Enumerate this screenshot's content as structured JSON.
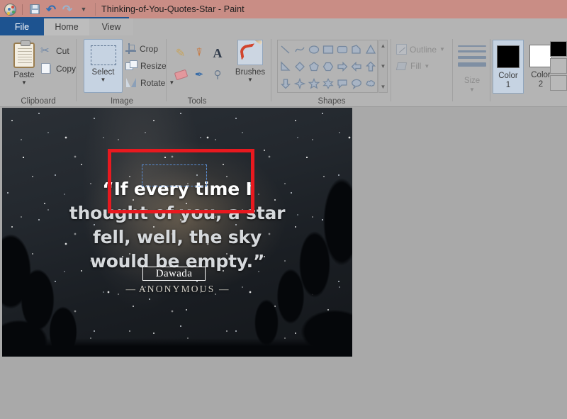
{
  "window": {
    "title": "Thinking-of-You-Quotes-Star - Paint",
    "quick_access": {
      "app_icon": "paint-palette-icon",
      "save": "save-icon",
      "undo": "undo-icon",
      "redo": "redo-icon",
      "customize": "chevron-down-icon"
    }
  },
  "tabs": [
    {
      "label": "File",
      "selected": true
    },
    {
      "label": "Home",
      "selected": false
    },
    {
      "label": "View",
      "selected": false
    }
  ],
  "ribbon": {
    "groups": [
      {
        "label": "Clipboard"
      },
      {
        "label": "Image"
      },
      {
        "label": "Tools"
      },
      {
        "label": "Shapes"
      }
    ],
    "clipboard": {
      "paste_label": "Paste",
      "cut_label": "Cut",
      "copy_label": "Copy",
      "paste_icon": "clipboard-icon",
      "cut_icon": "scissors-icon",
      "copy_icon": "copy-icon"
    },
    "image": {
      "select_label": "Select",
      "crop_label": "Crop",
      "resize_label": "Resize",
      "rotate_label": "Rotate",
      "select_icon": "dashed-rectangle-icon",
      "crop_icon": "crop-icon",
      "resize_icon": "resize-icon",
      "rotate_icon": "rotate-icon",
      "select_active": true
    },
    "tools": {
      "items": [
        {
          "name": "pencil-icon",
          "glyph": "✎"
        },
        {
          "name": "fill-with-color-icon",
          "glyph": "◢"
        },
        {
          "name": "text-icon",
          "glyph": "A"
        },
        {
          "name": "eraser-icon",
          "glyph": ""
        },
        {
          "name": "color-picker-icon",
          "glyph": "✒"
        },
        {
          "name": "magnifier-icon",
          "glyph": "⌕"
        }
      ]
    },
    "brushes": {
      "label": "Brushes",
      "icon": "paintbrush-icon"
    },
    "shapes": {
      "label": "Shapes",
      "items": [
        "line",
        "curve",
        "oval",
        "rectangle",
        "rounded-rectangle",
        "polygon",
        "triangle",
        "right-triangle",
        "diamond",
        "pentagon",
        "hexagon",
        "right-arrow",
        "left-arrow",
        "up-arrow",
        "down-arrow",
        "four-point-star",
        "five-point-star",
        "six-point-star",
        "rounded-rectangular-callout",
        "oval-callout",
        "cloud-callout"
      ],
      "scroll_up": "▲",
      "scroll_down": "▼",
      "scroll_more": "▼"
    },
    "outline_fill": {
      "outline_label": "Outline",
      "fill_label": "Fill",
      "outline_icon": "outline-icon",
      "fill_icon": "fill-icon",
      "disabled": true
    },
    "size": {
      "label": "Size",
      "icon": "line-thickness-icon",
      "disabled": true
    },
    "colors": {
      "color1_label": "Color",
      "color1_index": "1",
      "color2_label": "Color",
      "color2_index": "2",
      "color1_value": "#000000",
      "color2_value": "#ffffff",
      "color1_selected": true,
      "palette": [
        "#000000",
        "#c2c2c2",
        "#c2c2c2"
      ]
    }
  },
  "canvas": {
    "image_alt": "night-sky-milky-way-with-trees",
    "quote": {
      "line1": "“If every time I",
      "line2": "thought of you, a star",
      "line3": "fell, well, the sky",
      "line4": "would be empty.”",
      "attribution": "ANONYMOUS",
      "attribution_dash_left": "—",
      "attribution_dash_right": "—"
    },
    "text_tool": {
      "content": "Dawada",
      "has_frame": true
    },
    "selection": {
      "type": "rectangular-selection",
      "style": "dashed"
    },
    "annotation": {
      "type": "rectangle-highlight",
      "color": "#e8191f"
    }
  }
}
